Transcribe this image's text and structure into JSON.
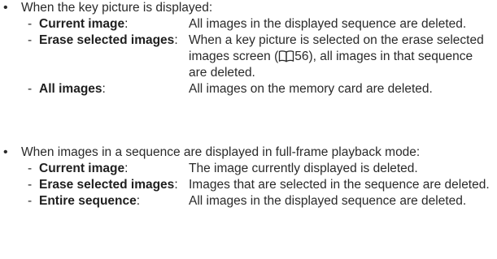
{
  "sections": [
    {
      "intro": "When the key picture is displayed:",
      "items": [
        {
          "term": "Current image",
          "desc": "All images in the displayed sequence are deleted."
        },
        {
          "term": "Erase selected images",
          "desc_before": "When a key picture is selected on the erase selected images screen (",
          "page_ref": "56",
          "desc_after": "), all images in that sequence are deleted."
        },
        {
          "term": "All images",
          "desc": "All images on the memory card are deleted."
        }
      ]
    },
    {
      "intro": "When images in a sequence are displayed in full-frame playback mode:",
      "items": [
        {
          "term": "Current image",
          "desc": "The image currently displayed is deleted."
        },
        {
          "term": "Erase selected images",
          "desc": "Images that are selected in the sequence are deleted."
        },
        {
          "term": "Entire sequence",
          "desc": "All images in the displayed sequence are deleted."
        }
      ]
    }
  ],
  "symbols": {
    "bullet": "•",
    "dash": "-",
    "colon": ":"
  },
  "icons": {
    "page_ref": "book-reference-icon"
  }
}
